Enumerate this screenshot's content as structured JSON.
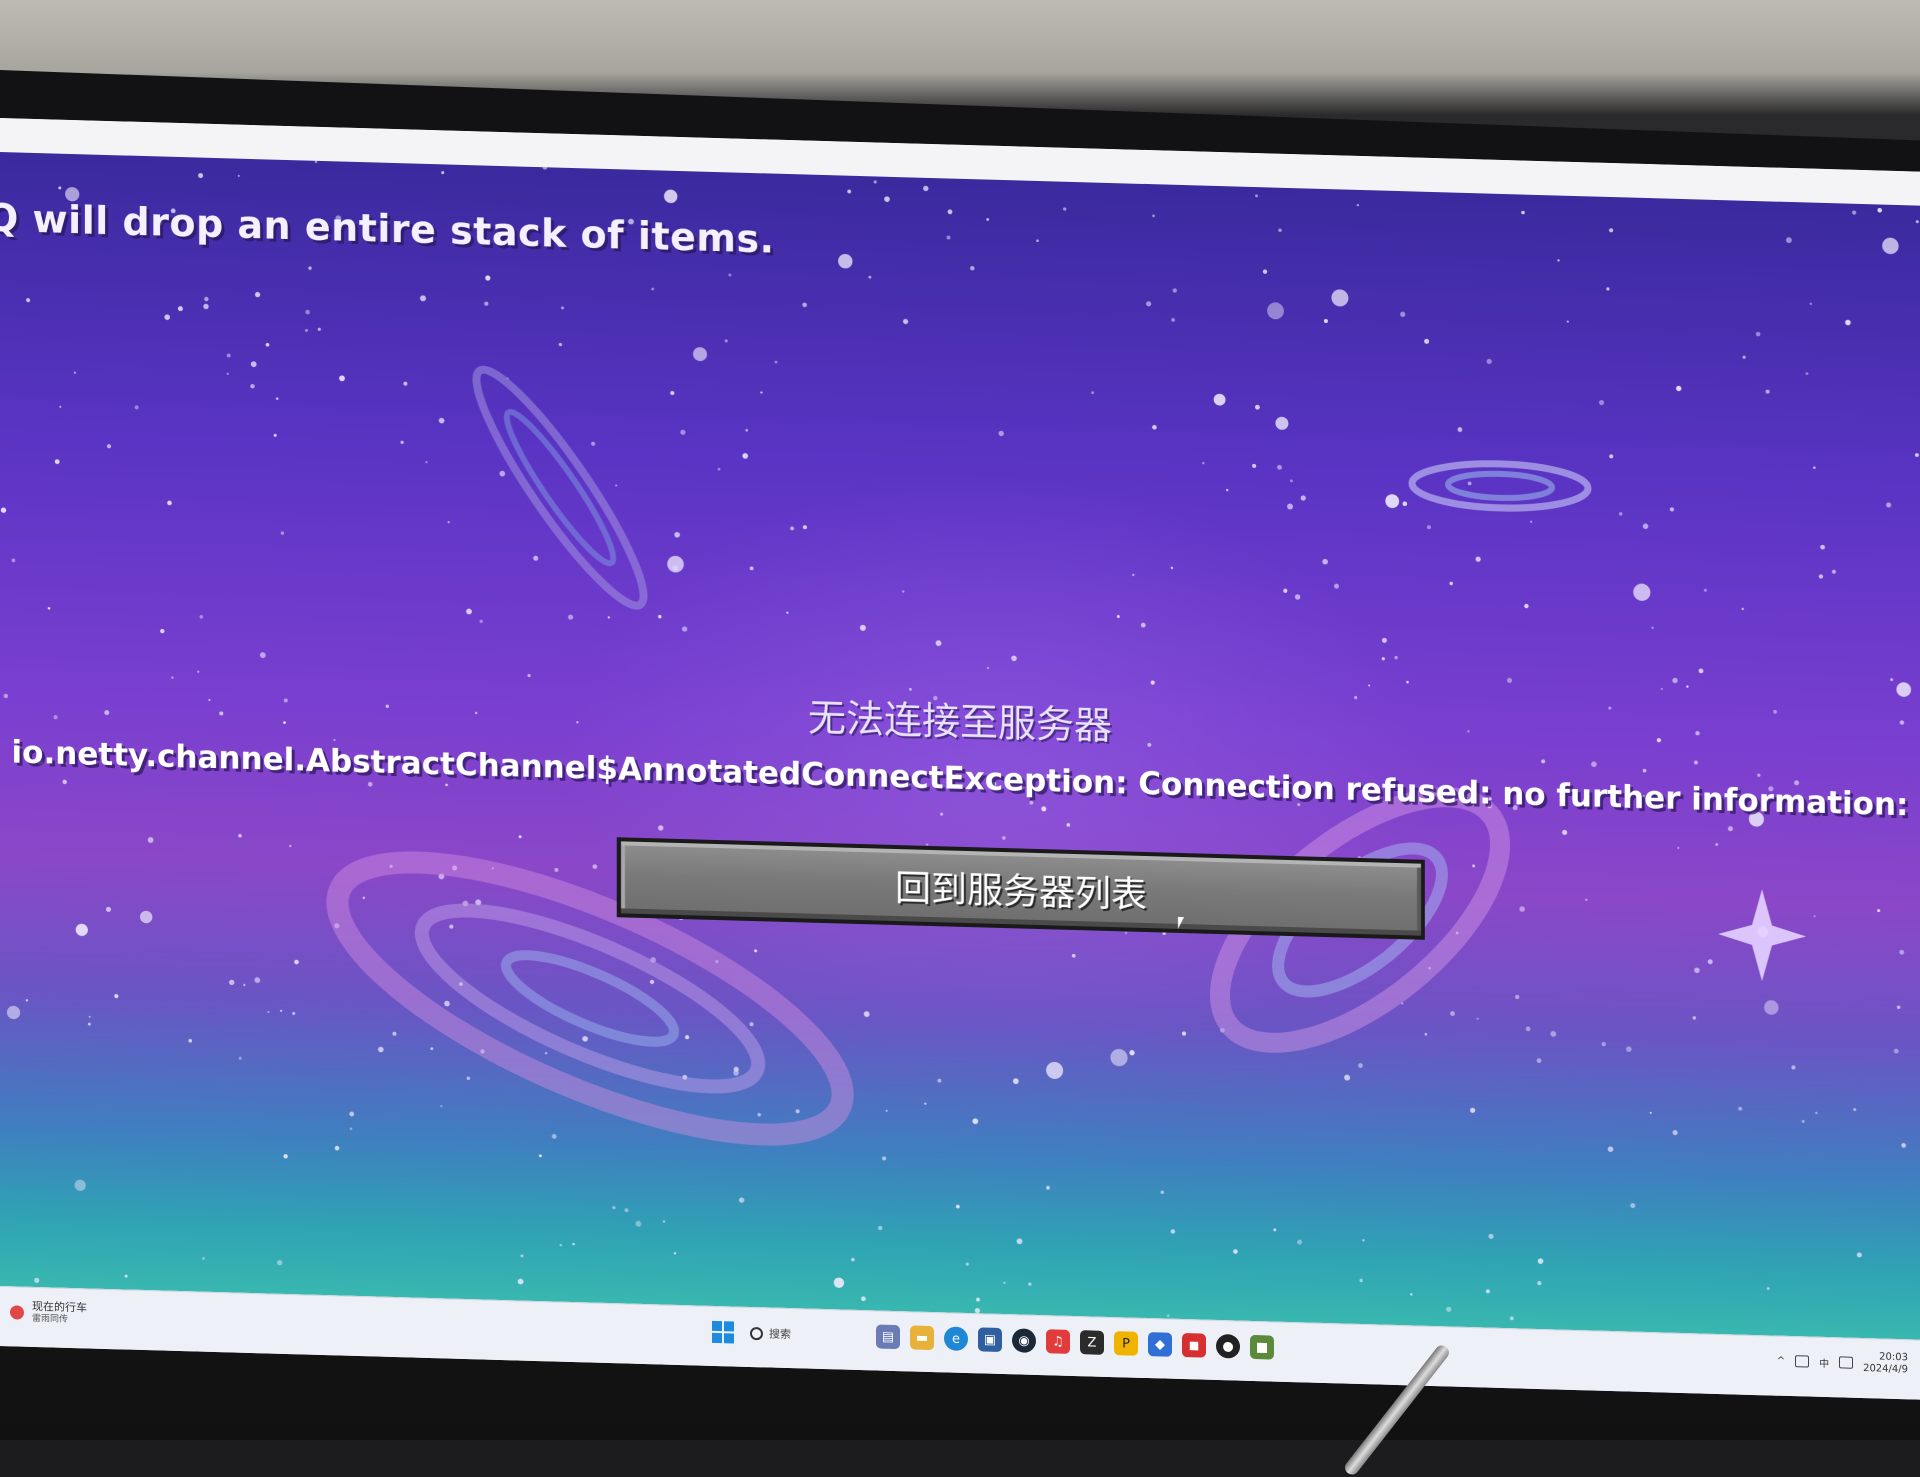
{
  "hint_text": "Q will drop an entire stack of items.",
  "dialog": {
    "title": "无法连接至服务器",
    "error_message": "io.netty.channel.AbstractChannel$AnnotatedConnectException: Connection refused: no further information:",
    "back_button_label": "回到服务器列表"
  },
  "taskbar": {
    "weather_line1": "现在的行车",
    "weather_line2": "雷雨同传",
    "search_label": "搜索",
    "apps": [
      "file-explorer-icon",
      "edge-icon",
      "store-icon",
      "steam-icon",
      "netease-music-icon",
      "app-z-icon",
      "app-p-icon",
      "app-blue-icon",
      "app-red-icon",
      "qq-icon",
      "minecraft-icon"
    ],
    "time": "20:03",
    "date": "2024/4/9"
  },
  "colors": {
    "sky_top": "#3a2a9e",
    "sky_mid": "#7a3fd0",
    "sky_bottom": "#39b7b0",
    "button_gray": "#7a7a7a"
  }
}
